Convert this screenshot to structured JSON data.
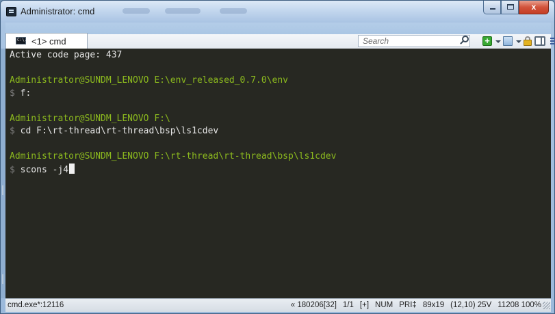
{
  "window": {
    "title": "Administrator: cmd",
    "close_label": "x"
  },
  "tabs": [
    {
      "label": "<1> cmd",
      "icon_text": "C:\\."
    }
  ],
  "toolbar": {
    "search_placeholder": "Search"
  },
  "console": {
    "lines": [
      {
        "type": "output",
        "text": "Active code page: 437"
      },
      {
        "type": "blank"
      },
      {
        "type": "prompt",
        "user": "Administrator@SUNDM_LENOVO",
        "path": "E:\\env_released_0.7.0\\env"
      },
      {
        "type": "command",
        "prefix": "$",
        "text": "f:"
      },
      {
        "type": "blank"
      },
      {
        "type": "prompt",
        "user": "Administrator@SUNDM_LENOVO",
        "path": "F:\\"
      },
      {
        "type": "command",
        "prefix": "$",
        "text": "cd F:\\rt-thread\\rt-thread\\bsp\\ls1cdev"
      },
      {
        "type": "blank"
      },
      {
        "type": "prompt",
        "user": "Administrator@SUNDM_LENOVO",
        "path": "F:\\rt-thread\\rt-thread\\bsp\\ls1cdev"
      },
      {
        "type": "command",
        "prefix": "$",
        "text": "scons -j4",
        "cursor": true
      }
    ],
    "colors": {
      "background": "#272822",
      "prompt": "#8cba1e",
      "text": "#e6e6e6",
      "dollar": "#7e7e7e"
    }
  },
  "statusbar": {
    "process": "cmd.exe*:12116",
    "build": "« 180206[32]",
    "tab_index": "1/1",
    "insert_mode": "[+]",
    "num_lock": "NUM",
    "priority": "PRI‡",
    "size": "89x19",
    "cursor_pos": "(12,10) 25V",
    "pid_zoom": "11208 100%"
  }
}
